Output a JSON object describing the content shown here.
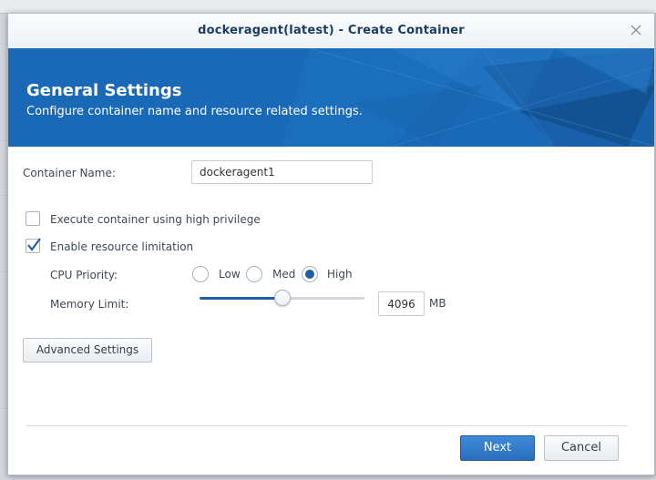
{
  "window": {
    "title": "dockeragent(latest) - Create Container"
  },
  "banner": {
    "title": "General Settings",
    "subtitle": "Configure container name and resource related settings."
  },
  "form": {
    "container_name_label": "Container Name:",
    "container_name_value": "dockeragent1",
    "high_privilege_label": "Execute container using high privilege",
    "high_privilege_checked": false,
    "resource_limit_label": "Enable resource limitation",
    "resource_limit_checked": true,
    "cpu_priority_label": "CPU Priority:",
    "cpu_options": [
      "Low",
      "Med",
      "High"
    ],
    "cpu_selected": "High",
    "memory_label": "Memory Limit:",
    "memory_value": "4096",
    "memory_unit": "MB",
    "memory_slider_fraction": 0.5
  },
  "buttons": {
    "advanced": "Advanced Settings",
    "next": "Next",
    "cancel": "Cancel"
  },
  "colors": {
    "banner": "#1a69b6",
    "accent": "#1f5fa8",
    "title_text": "#1b3c62"
  },
  "icons": {
    "close": "close-icon",
    "check": "checkmark-icon"
  }
}
